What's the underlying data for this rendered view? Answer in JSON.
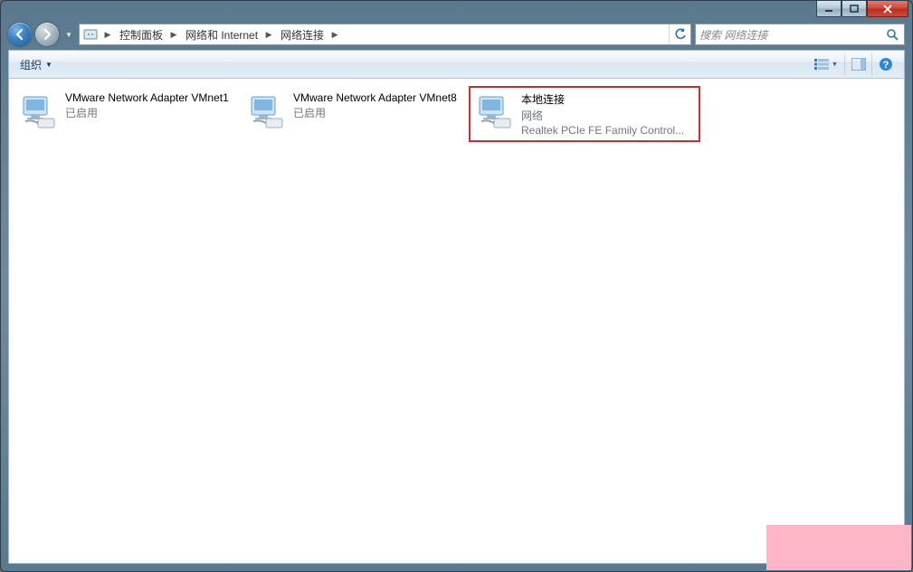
{
  "breadcrumb": {
    "item0": "控制面板",
    "item1": "网络和 Internet",
    "item2": "网络连接"
  },
  "search": {
    "placeholder": "搜索 网络连接"
  },
  "toolbar": {
    "organize": "组织"
  },
  "items": [
    {
      "title": "VMware Network Adapter VMnet1",
      "line2": "已启用",
      "line3": ""
    },
    {
      "title": "VMware Network Adapter VMnet8",
      "line2": "已启用",
      "line3": ""
    },
    {
      "title": "本地连接",
      "line2": "网络",
      "line3": "Realtek PCIe FE Family Control..."
    }
  ]
}
